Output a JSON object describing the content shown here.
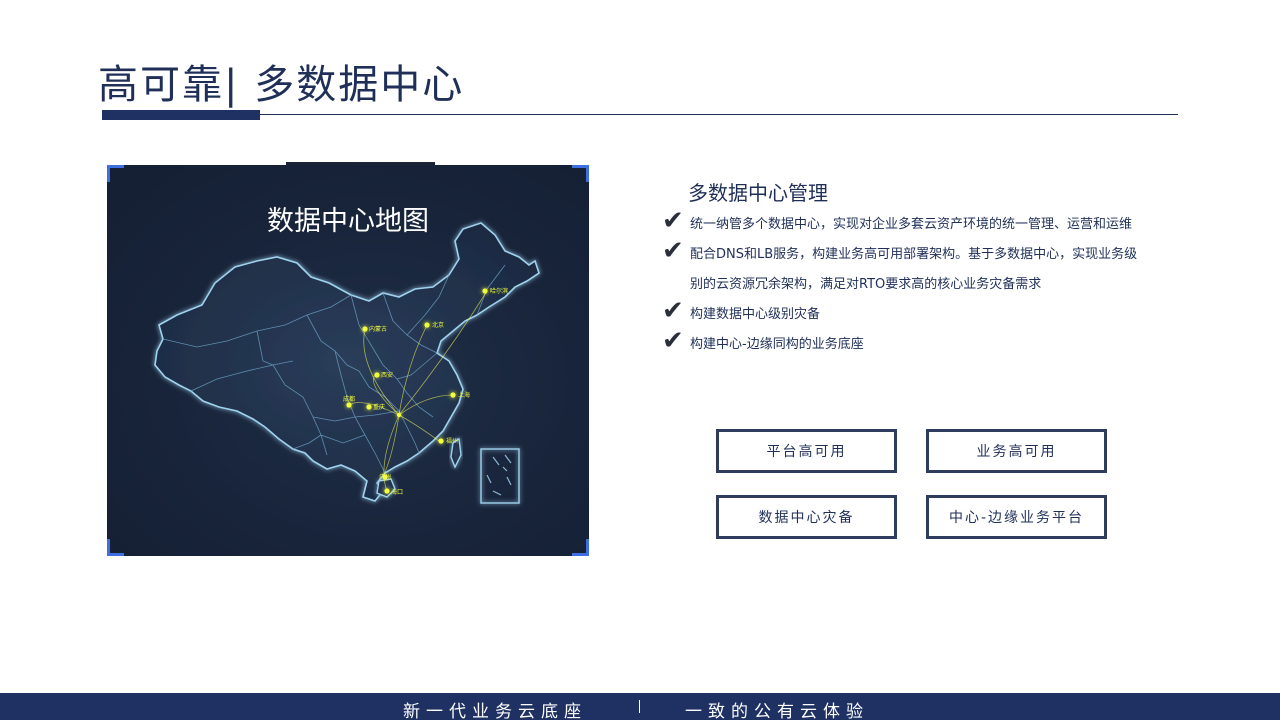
{
  "header": {
    "title": "高可靠| 多数据中心"
  },
  "map_panel": {
    "title": "数据中心地图",
    "cities": [
      "哈尔滨",
      "内蒙古",
      "北京",
      "西安",
      "上海",
      "成都",
      "重庆",
      "福州",
      "广州",
      "海口"
    ],
    "accent_color": "#3d6fe0",
    "glow_color": "#f4ff3a"
  },
  "management": {
    "heading": "多数据中心管理",
    "bullets": [
      "统一纳管多个数据中心，实现对企业多套云资产环境的统一管理、运营和运维",
      "配合DNS和LB服务，构建业务高可用部署架构。基于多数据中心，实现业务级别的云资源冗余架构，满足对RTO要求高的核心业务灾备需求",
      "构建数据中心级别灾备",
      "构建中心-边缘同构的业务底座"
    ]
  },
  "buttons": {
    "platform_ha": "平台高可用",
    "business_ha": "业务高可用",
    "dc_dr": "数据中心灾备",
    "center_edge": "中心-边缘业务平台"
  },
  "footer": {
    "left": "新一代业务云底座",
    "right": "一致的公有云体验"
  }
}
